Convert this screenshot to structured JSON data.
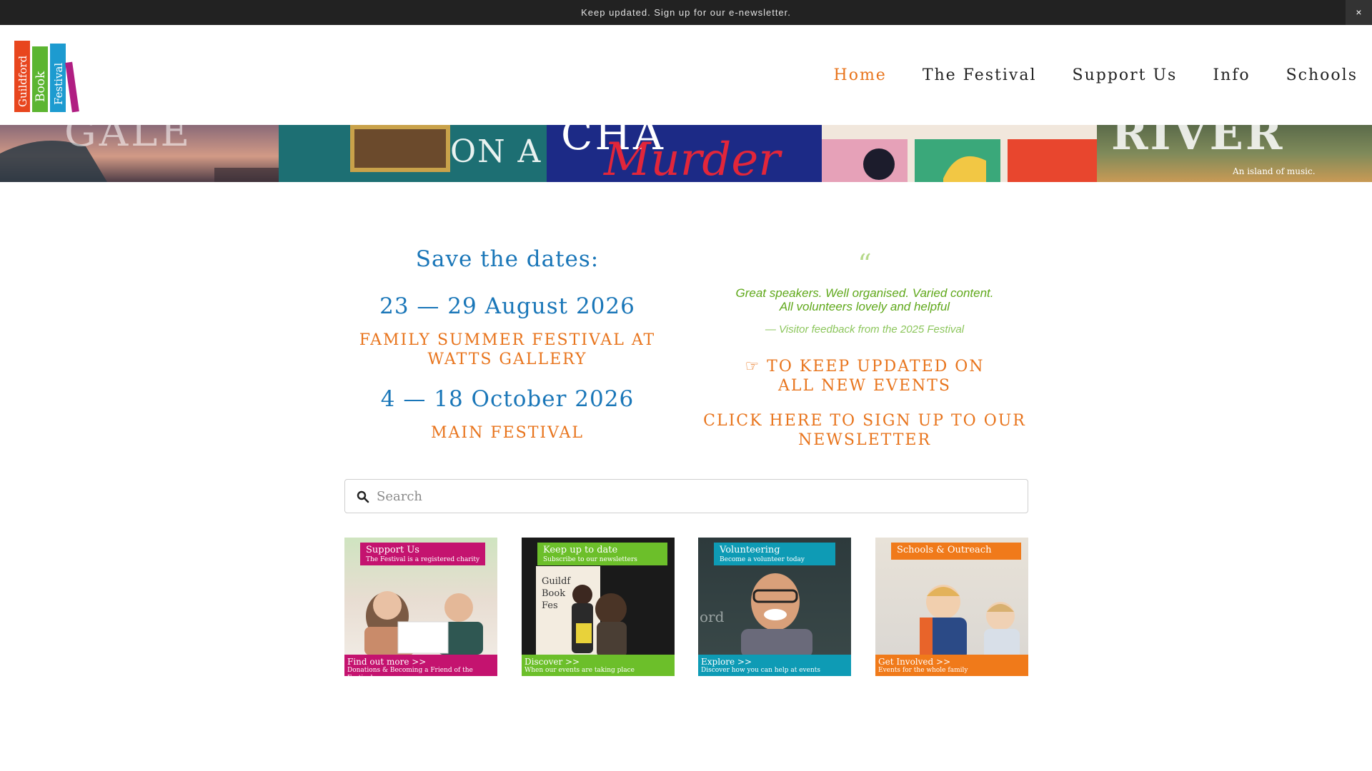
{
  "topbar": {
    "message": "Keep updated. Sign up for our e-newsletter.",
    "close_label": "×"
  },
  "logo": {
    "words": [
      "Guildford",
      "Book",
      "Festival"
    ],
    "colors": [
      "#e8461e",
      "#5cb531",
      "#1d9bd0",
      "#b01e82"
    ]
  },
  "nav": {
    "items": [
      {
        "label": "Home",
        "active": true
      },
      {
        "label": "The Festival",
        "active": false
      },
      {
        "label": "Support Us",
        "active": false
      },
      {
        "label": "Info",
        "active": false
      },
      {
        "label": "Schools",
        "active": false
      }
    ]
  },
  "banner": {
    "panels": [
      {
        "text": "GALE"
      },
      {
        "text": "ON A"
      },
      {
        "text": "Murder"
      },
      {
        "text": ""
      },
      {
        "text": "RIVER",
        "subtext": "An island of music."
      }
    ]
  },
  "dates": {
    "title": "Save the dates:",
    "event1_date": "23 — 29 August 2026",
    "event1_name": "FAMILY SUMMER FESTIVAL AT WATTS GALLERY",
    "event2_date": "4 — 18 October 2026",
    "event2_name": "MAIN FESTIVAL"
  },
  "testimonial": {
    "mark": "“",
    "line1": "Great speakers. Well organised. Varied content.",
    "line2": "All volunteers lovely and helpful",
    "cite": "— Visitor feedback from the 2025 Festival"
  },
  "newsletter": {
    "line1": "☞ TO KEEP UPDATED ON ALL NEW EVENTS",
    "line2": "CLICK HERE TO SIGN UP TO OUR NEWSLETTER"
  },
  "search": {
    "placeholder": "Search"
  },
  "tiles": [
    {
      "top_title": "Support Us",
      "top_sub": "The Festival is a registered charity",
      "bottom_title": "Find out more >>",
      "bottom_sub": "Donations & Becoming a Friend of the Festival",
      "color": "#c4136f"
    },
    {
      "top_title": "Keep up to date",
      "top_sub": "Subscribe to our newsletters",
      "bottom_title": "Discover >>",
      "bottom_sub": "When our events are taking place",
      "color": "#6cbf2a"
    },
    {
      "top_title": "Volunteering",
      "top_sub": "Become a volunteer today",
      "bottom_title": "Explore >>",
      "bottom_sub": "Discover how you can help at events",
      "color": "#0e9bb5"
    },
    {
      "top_title": "Schools & Outreach",
      "top_sub": "",
      "bottom_title": "Get Involved >>",
      "bottom_sub": "Events for the whole family",
      "color": "#f07a1a"
    }
  ]
}
